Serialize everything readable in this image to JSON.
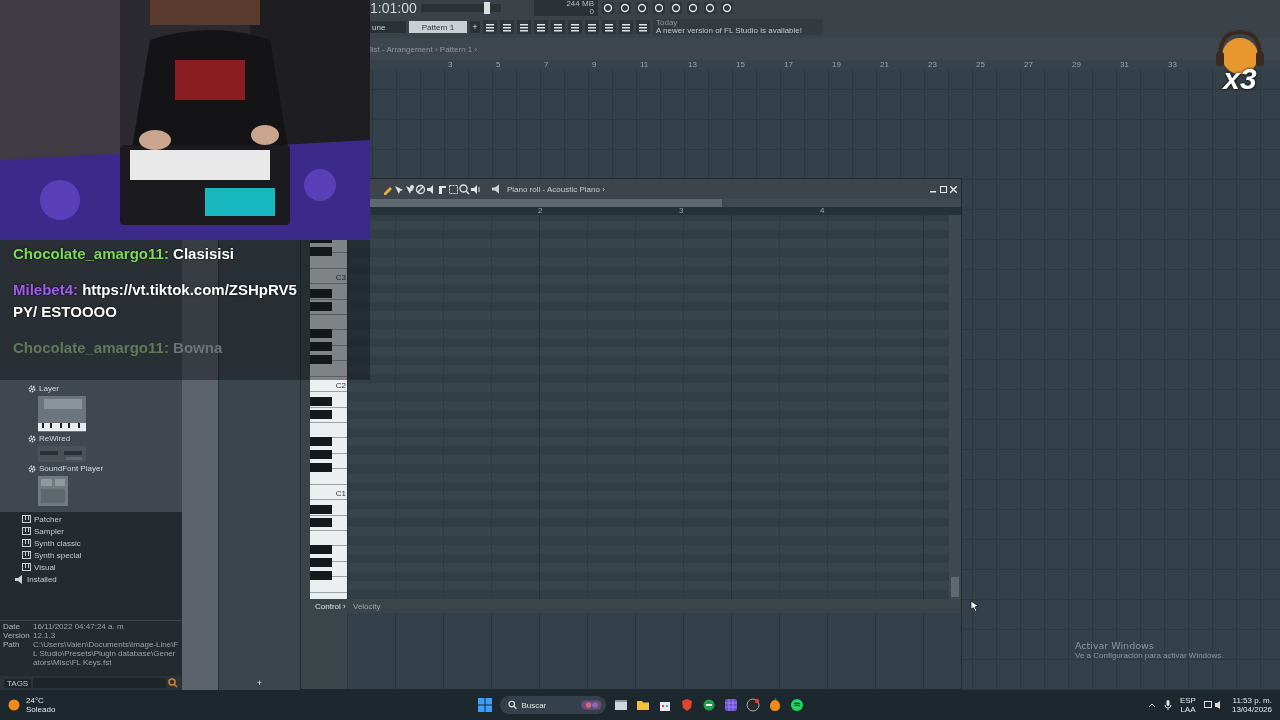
{
  "toolbar": {
    "time": "1:01:00",
    "master": {
      "level": 0.85
    },
    "memory": "244 MB",
    "voices": "0",
    "snap": "une",
    "pattern": "Pattern 1",
    "add": "+",
    "news_date": "Today",
    "news": "A newer version of FL Studio is available!"
  },
  "playlist": {
    "breadcrumb": "list - Arrangement › Pattern 1 ›",
    "bars": [
      "3",
      "5",
      "7",
      "9",
      "11",
      "13",
      "15",
      "17",
      "19",
      "21",
      "23",
      "25",
      "27",
      "29",
      "31",
      "33"
    ]
  },
  "browser": {
    "plugins": [
      {
        "name": "Layer"
      },
      {
        "name": "ReWired"
      },
      {
        "name": "SoundFont Player"
      }
    ],
    "tree": [
      {
        "name": "Patcher",
        "kind": "category"
      },
      {
        "name": "Sampler",
        "kind": "category"
      },
      {
        "name": "Synth classic",
        "kind": "category"
      },
      {
        "name": "Synth special",
        "kind": "category"
      },
      {
        "name": "Visual",
        "kind": "category"
      },
      {
        "name": "Installed",
        "kind": "group"
      }
    ],
    "info": [
      {
        "label": "Date",
        "value": "16/11/2022 04:47:24 a. m"
      },
      {
        "label": "Version",
        "value": "12.1.3"
      },
      {
        "label": "Path",
        "value": "C:\\Users\\Valen\\Documents\\Image-Line\\FL Studio\\Presets\\Plugin database\\Generators\\Misc\\FL Keys.fst"
      }
    ],
    "tags": "TAGS"
  },
  "channel_rack": {
    "add": "+"
  },
  "piano_roll": {
    "title": "Piano roll - Acoustic Piano ›",
    "bars": [
      "2",
      "3",
      "4"
    ],
    "octaves": [
      "C3",
      "C2",
      "C1"
    ],
    "control": "Control ›",
    "event": "Velocity"
  },
  "stream_overlay": {
    "multiplier": "x3",
    "chat": [
      {
        "user": "Chocolate_amargo11:",
        "text": "Clasisisi",
        "color": "#7ed957",
        "faded": false
      },
      {
        "user": "Milebet4:",
        "text": "https://vt.tiktok.com/ZSHpRV5PY/ ESTOOOO",
        "color": "#a35cf0",
        "faded": false
      },
      {
        "user": "Chocolate_amargo11:",
        "text": "Bowna",
        "color": "#5e7a57",
        "faded": true
      }
    ]
  },
  "activation_notice": {
    "title": "Activar Windows",
    "text": "Ve a Configuración para activar Windows."
  },
  "taskbar": {
    "temperature": "24°C",
    "weather": "Soleado",
    "search": {
      "placeholder": "Buscar"
    },
    "language": "ESP",
    "layout": "LAA",
    "time": "11:53 p. m.",
    "date": "13/04/2026"
  }
}
